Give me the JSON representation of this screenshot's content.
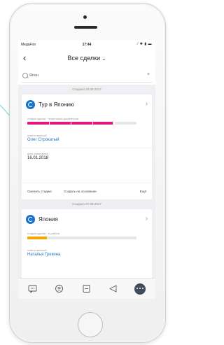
{
  "status_bar": {
    "carrier": "MegaFon",
    "time": "17:44",
    "indicators": "⁄ ✱ ▮ ▬"
  },
  "nav": {
    "back": "‹",
    "title": "Все сделки",
    "dropdown": "⌄"
  },
  "search": {
    "value": "Япон",
    "clear": "×"
  },
  "groups": [
    {
      "date": "Создано 20.09.2017",
      "card": {
        "name": "Тур в Японию",
        "arrow": "›",
        "stage_label": "стадия сделки · подготовка документов",
        "progress": 0.78,
        "progress_color": "#e3187f",
        "responsible_label": "ответственный",
        "responsible": "Олег Строкатый",
        "date_label": "дата изменения",
        "date_changed": "16.01.2018",
        "actions": [
          "Сменить стадию",
          "Создать на основании",
          "Ещё"
        ]
      }
    },
    {
      "date": "Создано 07.09.2017",
      "card": {
        "name": "Япония",
        "arrow": "›",
        "stage_label": "стадия сделки · в работе",
        "progress": 0.18,
        "progress_color": "#f7a600",
        "responsible_label": "ответственный",
        "responsible": "Наталья Грекина"
      }
    }
  ],
  "tabbar": {
    "icons": [
      "chat-icon",
      "feed-icon",
      "tasks-icon",
      "send-icon",
      "more-icon"
    ]
  },
  "colors": {
    "accent": "#1a73c8",
    "pink": "#e3187f",
    "orange": "#f7a600",
    "list_bg": "#efeff3"
  }
}
